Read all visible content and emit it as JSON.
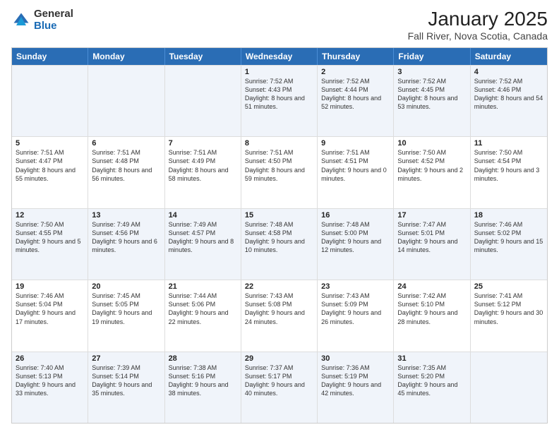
{
  "header": {
    "logo_general": "General",
    "logo_blue": "Blue",
    "title": "January 2025",
    "subtitle": "Fall River, Nova Scotia, Canada"
  },
  "weekdays": [
    "Sunday",
    "Monday",
    "Tuesday",
    "Wednesday",
    "Thursday",
    "Friday",
    "Saturday"
  ],
  "rows": [
    [
      {
        "day": "",
        "sunrise": "",
        "sunset": "",
        "daylight": ""
      },
      {
        "day": "",
        "sunrise": "",
        "sunset": "",
        "daylight": ""
      },
      {
        "day": "",
        "sunrise": "",
        "sunset": "",
        "daylight": ""
      },
      {
        "day": "1",
        "sunrise": "Sunrise: 7:52 AM",
        "sunset": "Sunset: 4:43 PM",
        "daylight": "Daylight: 8 hours and 51 minutes."
      },
      {
        "day": "2",
        "sunrise": "Sunrise: 7:52 AM",
        "sunset": "Sunset: 4:44 PM",
        "daylight": "Daylight: 8 hours and 52 minutes."
      },
      {
        "day": "3",
        "sunrise": "Sunrise: 7:52 AM",
        "sunset": "Sunset: 4:45 PM",
        "daylight": "Daylight: 8 hours and 53 minutes."
      },
      {
        "day": "4",
        "sunrise": "Sunrise: 7:52 AM",
        "sunset": "Sunset: 4:46 PM",
        "daylight": "Daylight: 8 hours and 54 minutes."
      }
    ],
    [
      {
        "day": "5",
        "sunrise": "Sunrise: 7:51 AM",
        "sunset": "Sunset: 4:47 PM",
        "daylight": "Daylight: 8 hours and 55 minutes."
      },
      {
        "day": "6",
        "sunrise": "Sunrise: 7:51 AM",
        "sunset": "Sunset: 4:48 PM",
        "daylight": "Daylight: 8 hours and 56 minutes."
      },
      {
        "day": "7",
        "sunrise": "Sunrise: 7:51 AM",
        "sunset": "Sunset: 4:49 PM",
        "daylight": "Daylight: 8 hours and 58 minutes."
      },
      {
        "day": "8",
        "sunrise": "Sunrise: 7:51 AM",
        "sunset": "Sunset: 4:50 PM",
        "daylight": "Daylight: 8 hours and 59 minutes."
      },
      {
        "day": "9",
        "sunrise": "Sunrise: 7:51 AM",
        "sunset": "Sunset: 4:51 PM",
        "daylight": "Daylight: 9 hours and 0 minutes."
      },
      {
        "day": "10",
        "sunrise": "Sunrise: 7:50 AM",
        "sunset": "Sunset: 4:52 PM",
        "daylight": "Daylight: 9 hours and 2 minutes."
      },
      {
        "day": "11",
        "sunrise": "Sunrise: 7:50 AM",
        "sunset": "Sunset: 4:54 PM",
        "daylight": "Daylight: 9 hours and 3 minutes."
      }
    ],
    [
      {
        "day": "12",
        "sunrise": "Sunrise: 7:50 AM",
        "sunset": "Sunset: 4:55 PM",
        "daylight": "Daylight: 9 hours and 5 minutes."
      },
      {
        "day": "13",
        "sunrise": "Sunrise: 7:49 AM",
        "sunset": "Sunset: 4:56 PM",
        "daylight": "Daylight: 9 hours and 6 minutes."
      },
      {
        "day": "14",
        "sunrise": "Sunrise: 7:49 AM",
        "sunset": "Sunset: 4:57 PM",
        "daylight": "Daylight: 9 hours and 8 minutes."
      },
      {
        "day": "15",
        "sunrise": "Sunrise: 7:48 AM",
        "sunset": "Sunset: 4:58 PM",
        "daylight": "Daylight: 9 hours and 10 minutes."
      },
      {
        "day": "16",
        "sunrise": "Sunrise: 7:48 AM",
        "sunset": "Sunset: 5:00 PM",
        "daylight": "Daylight: 9 hours and 12 minutes."
      },
      {
        "day": "17",
        "sunrise": "Sunrise: 7:47 AM",
        "sunset": "Sunset: 5:01 PM",
        "daylight": "Daylight: 9 hours and 14 minutes."
      },
      {
        "day": "18",
        "sunrise": "Sunrise: 7:46 AM",
        "sunset": "Sunset: 5:02 PM",
        "daylight": "Daylight: 9 hours and 15 minutes."
      }
    ],
    [
      {
        "day": "19",
        "sunrise": "Sunrise: 7:46 AM",
        "sunset": "Sunset: 5:04 PM",
        "daylight": "Daylight: 9 hours and 17 minutes."
      },
      {
        "day": "20",
        "sunrise": "Sunrise: 7:45 AM",
        "sunset": "Sunset: 5:05 PM",
        "daylight": "Daylight: 9 hours and 19 minutes."
      },
      {
        "day": "21",
        "sunrise": "Sunrise: 7:44 AM",
        "sunset": "Sunset: 5:06 PM",
        "daylight": "Daylight: 9 hours and 22 minutes."
      },
      {
        "day": "22",
        "sunrise": "Sunrise: 7:43 AM",
        "sunset": "Sunset: 5:08 PM",
        "daylight": "Daylight: 9 hours and 24 minutes."
      },
      {
        "day": "23",
        "sunrise": "Sunrise: 7:43 AM",
        "sunset": "Sunset: 5:09 PM",
        "daylight": "Daylight: 9 hours and 26 minutes."
      },
      {
        "day": "24",
        "sunrise": "Sunrise: 7:42 AM",
        "sunset": "Sunset: 5:10 PM",
        "daylight": "Daylight: 9 hours and 28 minutes."
      },
      {
        "day": "25",
        "sunrise": "Sunrise: 7:41 AM",
        "sunset": "Sunset: 5:12 PM",
        "daylight": "Daylight: 9 hours and 30 minutes."
      }
    ],
    [
      {
        "day": "26",
        "sunrise": "Sunrise: 7:40 AM",
        "sunset": "Sunset: 5:13 PM",
        "daylight": "Daylight: 9 hours and 33 minutes."
      },
      {
        "day": "27",
        "sunrise": "Sunrise: 7:39 AM",
        "sunset": "Sunset: 5:14 PM",
        "daylight": "Daylight: 9 hours and 35 minutes."
      },
      {
        "day": "28",
        "sunrise": "Sunrise: 7:38 AM",
        "sunset": "Sunset: 5:16 PM",
        "daylight": "Daylight: 9 hours and 38 minutes."
      },
      {
        "day": "29",
        "sunrise": "Sunrise: 7:37 AM",
        "sunset": "Sunset: 5:17 PM",
        "daylight": "Daylight: 9 hours and 40 minutes."
      },
      {
        "day": "30",
        "sunrise": "Sunrise: 7:36 AM",
        "sunset": "Sunset: 5:19 PM",
        "daylight": "Daylight: 9 hours and 42 minutes."
      },
      {
        "day": "31",
        "sunrise": "Sunrise: 7:35 AM",
        "sunset": "Sunset: 5:20 PM",
        "daylight": "Daylight: 9 hours and 45 minutes."
      },
      {
        "day": "",
        "sunrise": "",
        "sunset": "",
        "daylight": ""
      }
    ]
  ],
  "alt_rows": [
    0,
    2,
    4
  ]
}
